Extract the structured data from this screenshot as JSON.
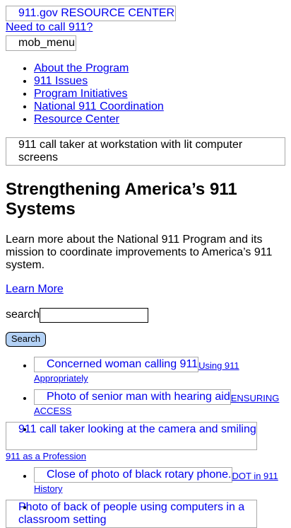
{
  "header": {
    "logo_alt": "911.gov RESOURCE CENTER",
    "call_link": "Need to call 911?",
    "menu_label": "mob_menu"
  },
  "nav": {
    "items": [
      "About the Program",
      "911 Issues",
      "Program Initiatives",
      "National 911 Coordination",
      "Resource Center"
    ]
  },
  "hero": {
    "image_alt": "911 call taker at workstation with lit computer screens",
    "title": "Strengthening America’s 911 Systems",
    "text": "Learn more about the National 911 Program and its mission to coordinate improvements to America’s 911 system.",
    "cta": "Learn More"
  },
  "search": {
    "label": "search",
    "value": "",
    "button": "Search"
  },
  "cards": [
    {
      "image_alt": "Concerned woman calling 911",
      "link": "Using 911 Appropriately"
    },
    {
      "image_alt": "Photo of senior man with hearing aid",
      "link": "ENSURING ACCESS"
    },
    {
      "image_alt": "911 call taker looking at the camera and smiling",
      "link": "911 as a Profession"
    },
    {
      "image_alt": "Close of photo of black rotary phone.",
      "link": "DOT in 911 History"
    },
    {
      "image_alt": "Photo of back of people using computers in a classroom setting",
      "link": ""
    }
  ]
}
